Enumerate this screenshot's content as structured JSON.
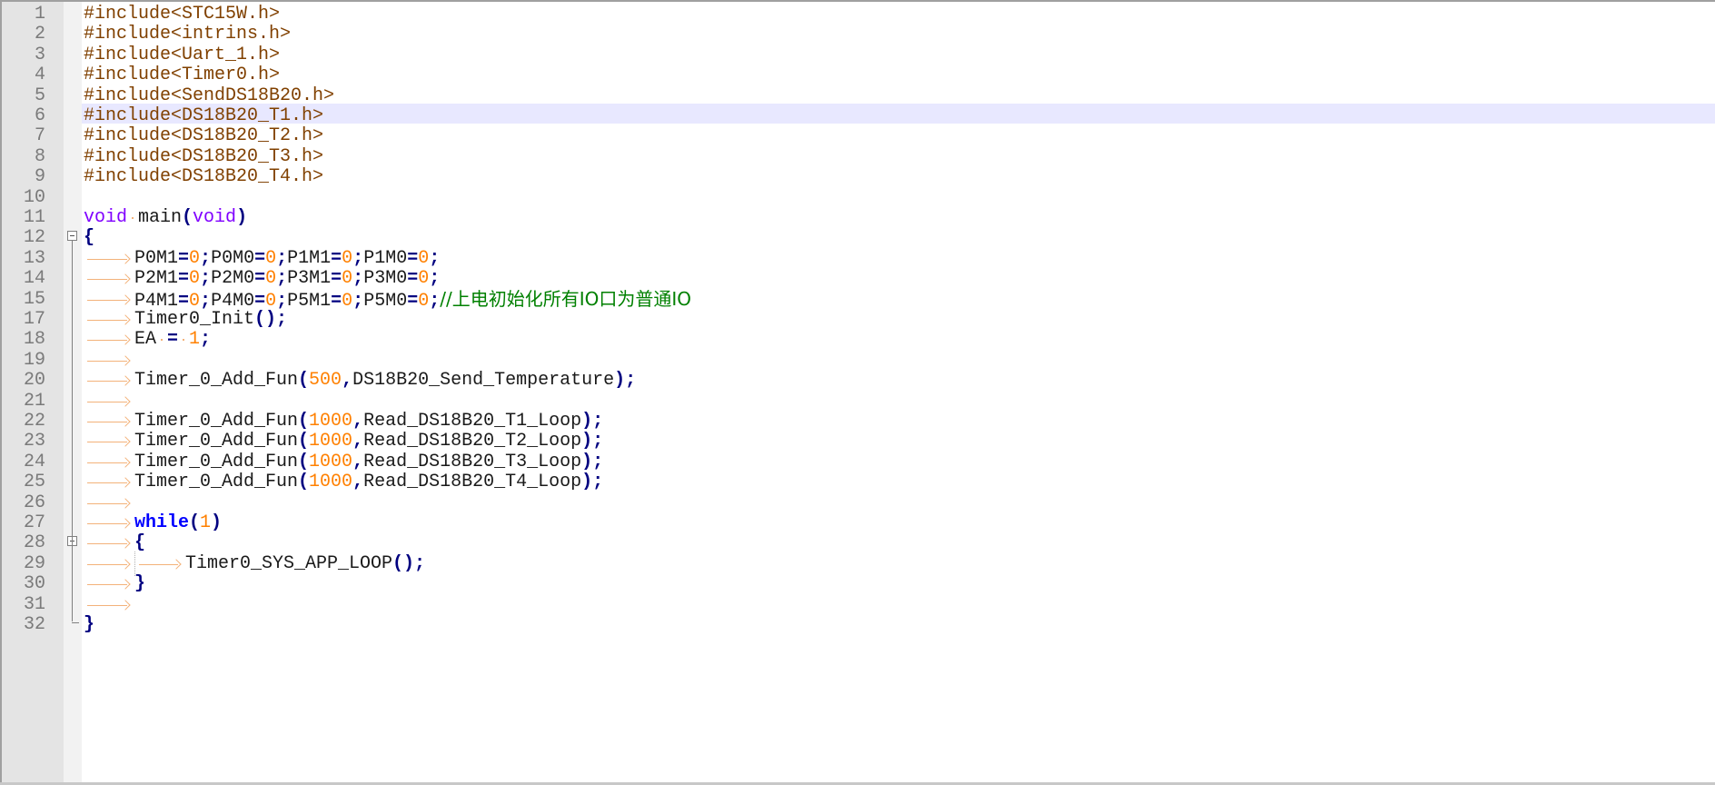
{
  "editor": {
    "colors": {
      "preprocessor": "#804000",
      "type_keyword": "#8000ff",
      "keyword": "#0000ff",
      "operator": "#000080",
      "number": "#ff8000",
      "comment": "#008000",
      "current_line": "#e8e8ff",
      "gutter": "#e4e4e4",
      "tab_arrow": "#f3b27a"
    },
    "current_line_number": "6",
    "fold_markers": [
      {
        "line": "12",
        "icon": "fold-minus-icon"
      },
      {
        "line": "28",
        "icon": "fold-minus-icon"
      }
    ],
    "lines": [
      {
        "no": "1",
        "tokens": [
          {
            "t": "pp",
            "v": "#include<STC15W.h>"
          }
        ]
      },
      {
        "no": "2",
        "tokens": [
          {
            "t": "pp",
            "v": "#include<intrins.h>"
          }
        ]
      },
      {
        "no": "3",
        "tokens": [
          {
            "t": "pp",
            "v": "#include<Uart_1.h>"
          }
        ]
      },
      {
        "no": "4",
        "tokens": [
          {
            "t": "pp",
            "v": "#include<Timer0.h>"
          }
        ]
      },
      {
        "no": "5",
        "tokens": [
          {
            "t": "pp",
            "v": "#include<SendDS18B20.h>"
          }
        ]
      },
      {
        "no": "6",
        "tokens": [
          {
            "t": "pp",
            "v": "#include<DS18B20_T1.h>"
          }
        ]
      },
      {
        "no": "7",
        "tokens": [
          {
            "t": "pp",
            "v": "#include<DS18B20_T2.h>"
          }
        ]
      },
      {
        "no": "8",
        "tokens": [
          {
            "t": "pp",
            "v": "#include<DS18B20_T3.h>"
          }
        ]
      },
      {
        "no": "9",
        "tokens": [
          {
            "t": "pp",
            "v": "#include<DS18B20_T4.h>"
          }
        ]
      },
      {
        "no": "10",
        "tokens": []
      },
      {
        "no": "11",
        "tokens": [
          {
            "t": "kw-type",
            "v": "void"
          },
          {
            "t": "sp"
          },
          {
            "t": "txt",
            "v": "main"
          },
          {
            "t": "op",
            "v": "("
          },
          {
            "t": "kw-type",
            "v": "void"
          },
          {
            "t": "op",
            "v": ")"
          }
        ]
      },
      {
        "no": "12",
        "tokens": [
          {
            "t": "op",
            "v": "{"
          }
        ]
      },
      {
        "no": "13",
        "tokens": [
          {
            "t": "tab"
          },
          {
            "t": "txt",
            "v": "P0M1"
          },
          {
            "t": "op",
            "v": "="
          },
          {
            "t": "num",
            "v": "0"
          },
          {
            "t": "op",
            "v": ";"
          },
          {
            "t": "txt",
            "v": "P0M0"
          },
          {
            "t": "op",
            "v": "="
          },
          {
            "t": "num",
            "v": "0"
          },
          {
            "t": "op",
            "v": ";"
          },
          {
            "t": "txt",
            "v": "P1M1"
          },
          {
            "t": "op",
            "v": "="
          },
          {
            "t": "num",
            "v": "0"
          },
          {
            "t": "op",
            "v": ";"
          },
          {
            "t": "txt",
            "v": "P1M0"
          },
          {
            "t": "op",
            "v": "="
          },
          {
            "t": "num",
            "v": "0"
          },
          {
            "t": "op",
            "v": ";"
          }
        ]
      },
      {
        "no": "14",
        "tokens": [
          {
            "t": "tab"
          },
          {
            "t": "txt",
            "v": "P2M1"
          },
          {
            "t": "op",
            "v": "="
          },
          {
            "t": "num",
            "v": "0"
          },
          {
            "t": "op",
            "v": ";"
          },
          {
            "t": "txt",
            "v": "P2M0"
          },
          {
            "t": "op",
            "v": "="
          },
          {
            "t": "num",
            "v": "0"
          },
          {
            "t": "op",
            "v": ";"
          },
          {
            "t": "txt",
            "v": "P3M1"
          },
          {
            "t": "op",
            "v": "="
          },
          {
            "t": "num",
            "v": "0"
          },
          {
            "t": "op",
            "v": ";"
          },
          {
            "t": "txt",
            "v": "P3M0"
          },
          {
            "t": "op",
            "v": "="
          },
          {
            "t": "num",
            "v": "0"
          },
          {
            "t": "op",
            "v": ";"
          }
        ]
      },
      {
        "no": "15",
        "tokens": [
          {
            "t": "tab"
          },
          {
            "t": "txt",
            "v": "P4M1"
          },
          {
            "t": "op",
            "v": "="
          },
          {
            "t": "num",
            "v": "0"
          },
          {
            "t": "op",
            "v": ";"
          },
          {
            "t": "txt",
            "v": "P4M0"
          },
          {
            "t": "op",
            "v": "="
          },
          {
            "t": "num",
            "v": "0"
          },
          {
            "t": "op",
            "v": ";"
          },
          {
            "t": "txt",
            "v": "P5M1"
          },
          {
            "t": "op",
            "v": "="
          },
          {
            "t": "num",
            "v": "0"
          },
          {
            "t": "op",
            "v": ";"
          },
          {
            "t": "txt",
            "v": "P5M0"
          },
          {
            "t": "op",
            "v": "="
          },
          {
            "t": "num",
            "v": "0"
          },
          {
            "t": "op",
            "v": ";"
          },
          {
            "t": "cmt",
            "v": "//上电初始化所有IO口为普通IO"
          }
        ]
      },
      {
        "no": "17",
        "tokens": [
          {
            "t": "tab"
          },
          {
            "t": "txt",
            "v": "Timer0_Init"
          },
          {
            "t": "op",
            "v": "();"
          }
        ]
      },
      {
        "no": "18",
        "tokens": [
          {
            "t": "tab"
          },
          {
            "t": "txt",
            "v": "EA"
          },
          {
            "t": "sp"
          },
          {
            "t": "op",
            "v": "="
          },
          {
            "t": "sp"
          },
          {
            "t": "num",
            "v": "1"
          },
          {
            "t": "op",
            "v": ";"
          }
        ]
      },
      {
        "no": "19",
        "tokens": [
          {
            "t": "tab"
          }
        ]
      },
      {
        "no": "20",
        "tokens": [
          {
            "t": "tab"
          },
          {
            "t": "txt",
            "v": "Timer_0_Add_Fun"
          },
          {
            "t": "op",
            "v": "("
          },
          {
            "t": "num",
            "v": "500"
          },
          {
            "t": "op",
            "v": ","
          },
          {
            "t": "txt",
            "v": "DS18B20_Send_Temperature"
          },
          {
            "t": "op",
            "v": ");"
          }
        ]
      },
      {
        "no": "21",
        "tokens": [
          {
            "t": "tab"
          }
        ]
      },
      {
        "no": "22",
        "tokens": [
          {
            "t": "tab"
          },
          {
            "t": "txt",
            "v": "Timer_0_Add_Fun"
          },
          {
            "t": "op",
            "v": "("
          },
          {
            "t": "num",
            "v": "1000"
          },
          {
            "t": "op",
            "v": ","
          },
          {
            "t": "txt",
            "v": "Read_DS18B20_T1_Loop"
          },
          {
            "t": "op",
            "v": ");"
          }
        ]
      },
      {
        "no": "23",
        "tokens": [
          {
            "t": "tab"
          },
          {
            "t": "txt",
            "v": "Timer_0_Add_Fun"
          },
          {
            "t": "op",
            "v": "("
          },
          {
            "t": "num",
            "v": "1000"
          },
          {
            "t": "op",
            "v": ","
          },
          {
            "t": "txt",
            "v": "Read_DS18B20_T2_Loop"
          },
          {
            "t": "op",
            "v": ");"
          }
        ]
      },
      {
        "no": "24",
        "tokens": [
          {
            "t": "tab"
          },
          {
            "t": "txt",
            "v": "Timer_0_Add_Fun"
          },
          {
            "t": "op",
            "v": "("
          },
          {
            "t": "num",
            "v": "1000"
          },
          {
            "t": "op",
            "v": ","
          },
          {
            "t": "txt",
            "v": "Read_DS18B20_T3_Loop"
          },
          {
            "t": "op",
            "v": ");"
          }
        ]
      },
      {
        "no": "25",
        "tokens": [
          {
            "t": "tab"
          },
          {
            "t": "txt",
            "v": "Timer_0_Add_Fun"
          },
          {
            "t": "op",
            "v": "("
          },
          {
            "t": "num",
            "v": "1000"
          },
          {
            "t": "op",
            "v": ","
          },
          {
            "t": "txt",
            "v": "Read_DS18B20_T4_Loop"
          },
          {
            "t": "op",
            "v": ");"
          }
        ]
      },
      {
        "no": "26",
        "tokens": [
          {
            "t": "tab"
          }
        ]
      },
      {
        "no": "27",
        "tokens": [
          {
            "t": "tab"
          },
          {
            "t": "kw",
            "v": "while"
          },
          {
            "t": "op",
            "v": "("
          },
          {
            "t": "num",
            "v": "1"
          },
          {
            "t": "op",
            "v": ")"
          }
        ]
      },
      {
        "no": "28",
        "tokens": [
          {
            "t": "tab"
          },
          {
            "t": "op",
            "v": "{"
          }
        ]
      },
      {
        "no": "29",
        "tokens": [
          {
            "t": "tab"
          },
          {
            "t": "tab",
            "guide": true
          },
          {
            "t": "txt",
            "v": "Timer0_SYS_APP_LOOP"
          },
          {
            "t": "op",
            "v": "();"
          }
        ]
      },
      {
        "no": "30",
        "tokens": [
          {
            "t": "tab"
          },
          {
            "t": "op",
            "v": "}"
          }
        ]
      },
      {
        "no": "31",
        "tokens": [
          {
            "t": "tab"
          }
        ]
      },
      {
        "no": "32",
        "tokens": [
          {
            "t": "op",
            "v": "}"
          }
        ]
      }
    ]
  }
}
